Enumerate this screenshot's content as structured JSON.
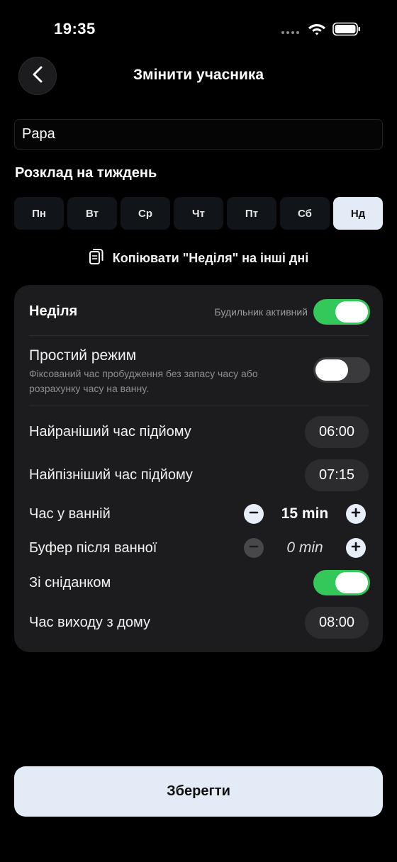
{
  "status_bar": {
    "time": "19:35"
  },
  "header": {
    "title": "Змінити учасника"
  },
  "name_field": {
    "value": "Papa"
  },
  "schedule": {
    "title": "Розклад на тиждень",
    "days": [
      "Пн",
      "Вт",
      "Ср",
      "Чт",
      "Пт",
      "Сб",
      "Нд"
    ],
    "selected_day": "Нд",
    "copy_label": "Копіювати \"Неділя\" на інші дні"
  },
  "day_card": {
    "title": "Неділя",
    "alarm_active_label": "Будильник активний",
    "alarm_active": true,
    "simple_mode": {
      "title": "Простий режим",
      "description": "Фіксований час пробудження без запасу часу або розрахунку часу на ванну.",
      "enabled": false
    },
    "earliest_wake": {
      "label": "Найраніший час підйому",
      "value": "06:00"
    },
    "latest_wake": {
      "label": "Найпізніший час підйому",
      "value": "07:15"
    },
    "bathroom_time": {
      "label": "Час у ванній",
      "value": "15 min"
    },
    "buffer_after_bathroom": {
      "label": "Буфер після ванної",
      "value": "0 min"
    },
    "with_breakfast": {
      "label": "Зі сніданком",
      "enabled": true
    },
    "leave_home": {
      "label": "Час виходу з дому",
      "value": "08:00"
    }
  },
  "save_label": "Зберегти",
  "colors": {
    "background": "#000000",
    "card": "#1c1c1e",
    "accent_light": "#e3ecf6",
    "toggle_on": "#34c759",
    "toggle_off": "#3a3a3c"
  },
  "icons": {
    "back": "chevron-left-icon",
    "copy": "copy-icon",
    "wifi": "wifi-icon",
    "battery": "battery-icon",
    "minus": "minus-icon",
    "plus": "plus-icon"
  }
}
